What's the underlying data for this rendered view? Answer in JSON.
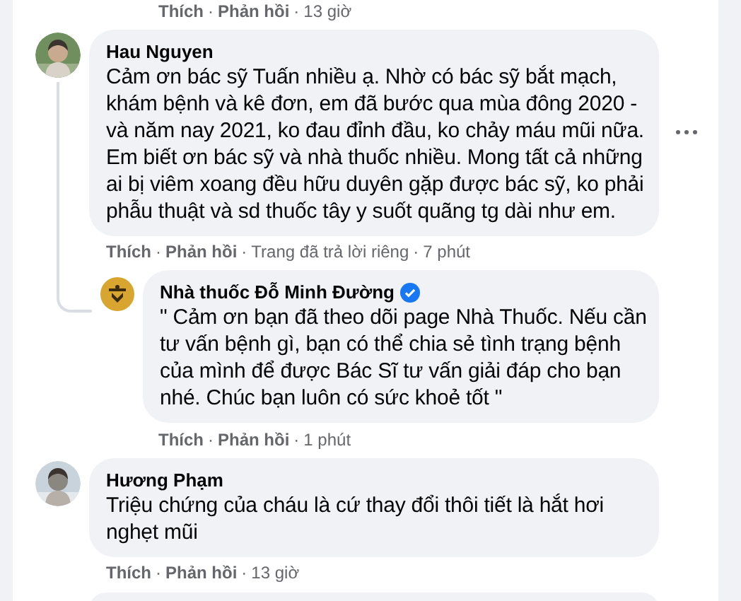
{
  "separator": "·",
  "top_actions": {
    "actions": [
      "Thích",
      "Phản hồi"
    ],
    "meta": [
      "13 giờ"
    ]
  },
  "comments": [
    {
      "author": "Hau Nguyen",
      "kind": "person",
      "verified": false,
      "menu_visible": true,
      "text": "Cảm ơn bác sỹ Tuấn nhiều ạ. Nhờ có bác sỹ bắt mạch, khám bệnh và kê đơn, em đã bước qua mùa đông 2020 - và năm nay 2021, ko đau đỉnh đầu, ko chảy máu mũi nữa. Em biết ơn bác sỹ và nhà thuốc nhiều. Mong tất cả những ai bị viêm xoang đều hữu duyên gặp được bác sỹ, ko phải phẫu thuật và sd thuốc tây y suốt quãng tg dài như em.",
      "actions": [
        "Thích",
        "Phản hồi"
      ],
      "meta": [
        "Trang đã trả lời riêng",
        "7 phút"
      ],
      "replies": [
        {
          "author": "Nhà thuốc Đỗ Minh Đường",
          "kind": "page",
          "verified": true,
          "menu_visible": false,
          "text": "\" Cảm ơn bạn đã theo dõi page Nhà Thuốc. Nếu cần tư vấn bệnh gì, bạn có thể chia sẻ tình trạng bệnh của mình để được Bác Sĩ tư vấn giải đáp cho bạn nhé. Chúc bạn luôn có sức khoẻ tốt \"",
          "actions": [
            "Thích",
            "Phản hồi"
          ],
          "meta": [
            "1 phút"
          ]
        }
      ]
    },
    {
      "author": "Hương Phạm",
      "kind": "person",
      "verified": false,
      "menu_visible": false,
      "text": "Triệu chứng của cháu là cứ thay đổi thôi tiết là hắt hơi nghẹt mũi",
      "actions": [
        "Thích",
        "Phản hồi"
      ],
      "meta": [
        "13 giờ"
      ]
    }
  ]
}
